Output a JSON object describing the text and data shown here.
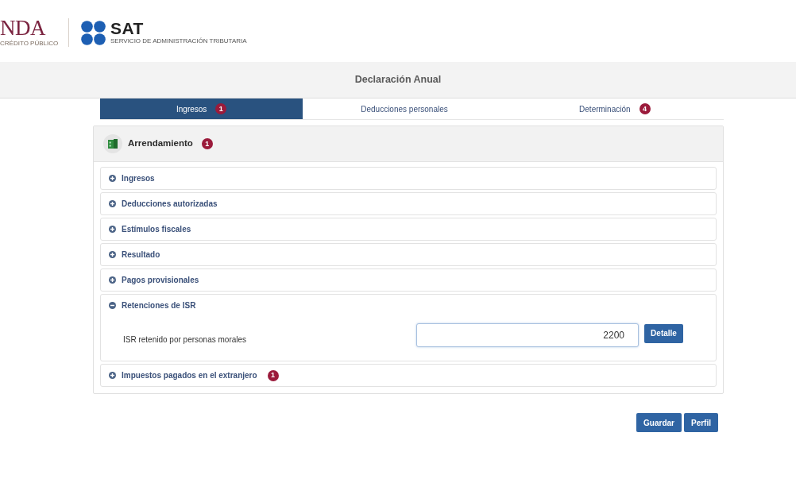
{
  "header": {
    "hacienda_logo": {
      "wordmark": "NDA",
      "subtitle": "CRÉDITO PÚBLICO"
    },
    "sat_logo": {
      "wordmark": "SAT",
      "subtitle": "SERVICIO DE ADMINISTRACIÓN TRIBUTARIA"
    }
  },
  "title": "Declaración Anual",
  "tabs": [
    {
      "label": "Ingresos",
      "badge": "1",
      "selected": true
    },
    {
      "label": "Deducciones personales",
      "selected": false
    },
    {
      "label": "Determinación",
      "badge": "4",
      "selected": false
    }
  ],
  "panel": {
    "title": "Arrendamiento",
    "badge": "1",
    "sections": [
      {
        "label": "Ingresos",
        "expanded": false
      },
      {
        "label": "Deducciones autorizadas",
        "expanded": false
      },
      {
        "label": "Estímulos fiscales",
        "expanded": false
      },
      {
        "label": "Resultado",
        "expanded": false
      },
      {
        "label": "Pagos provisionales",
        "expanded": false
      },
      {
        "label": "Retenciones de ISR",
        "expanded": true,
        "fields": [
          {
            "label": "ISR retenido por personas morales",
            "value": "2200",
            "button": "Detalle"
          }
        ]
      },
      {
        "label": "Impuestos pagados en el extranjero",
        "badge": "1",
        "expanded": false
      }
    ]
  },
  "actions": [
    "Guardar",
    "Perfil"
  ]
}
